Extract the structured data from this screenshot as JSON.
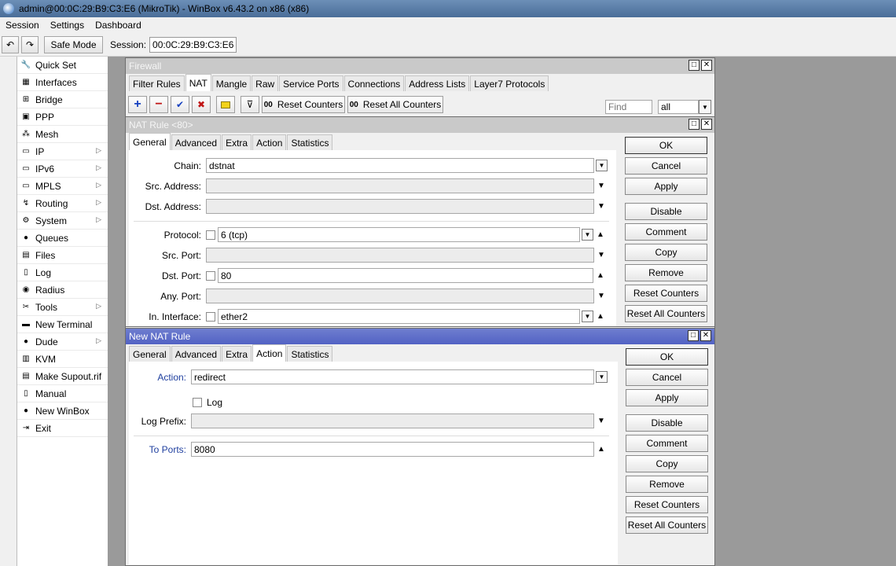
{
  "app": {
    "title": "admin@00:0C:29:B9:C3:E6 (MikroTik) - WinBox v6.43.2 on x86 (x86)"
  },
  "menu": [
    "Session",
    "Settings",
    "Dashboard"
  ],
  "toolbar": {
    "safe_mode": "Safe Mode",
    "session_label": "Session:",
    "session_value": "00:0C:29:B9:C3:E6"
  },
  "sidebar": [
    {
      "label": "Quick Set",
      "icon": "quickset-icon",
      "sub": false
    },
    {
      "label": "Interfaces",
      "icon": "interfaces-icon",
      "sub": false
    },
    {
      "label": "Bridge",
      "icon": "bridge-icon",
      "sub": false
    },
    {
      "label": "PPP",
      "icon": "ppp-icon",
      "sub": false
    },
    {
      "label": "Mesh",
      "icon": "mesh-icon",
      "sub": false
    },
    {
      "label": "IP",
      "icon": "ip-icon",
      "sub": true
    },
    {
      "label": "IPv6",
      "icon": "ipv6-icon",
      "sub": true
    },
    {
      "label": "MPLS",
      "icon": "mpls-icon",
      "sub": true
    },
    {
      "label": "Routing",
      "icon": "routing-icon",
      "sub": true
    },
    {
      "label": "System",
      "icon": "system-icon",
      "sub": true
    },
    {
      "label": "Queues",
      "icon": "queues-icon",
      "sub": false
    },
    {
      "label": "Files",
      "icon": "files-icon",
      "sub": false
    },
    {
      "label": "Log",
      "icon": "log-icon",
      "sub": false
    },
    {
      "label": "Radius",
      "icon": "radius-icon",
      "sub": false
    },
    {
      "label": "Tools",
      "icon": "tools-icon",
      "sub": true
    },
    {
      "label": "New Terminal",
      "icon": "terminal-icon",
      "sub": false
    },
    {
      "label": "Dude",
      "icon": "dude-icon",
      "sub": true
    },
    {
      "label": "KVM",
      "icon": "kvm-icon",
      "sub": false
    },
    {
      "label": "Make Supout.rif",
      "icon": "supout-icon",
      "sub": false
    },
    {
      "label": "Manual",
      "icon": "manual-icon",
      "sub": false
    },
    {
      "label": "New WinBox",
      "icon": "winbox-icon",
      "sub": false
    },
    {
      "label": "Exit",
      "icon": "exit-icon",
      "sub": false
    }
  ],
  "firewall": {
    "title": "Firewall",
    "tabs": [
      "Filter Rules",
      "NAT",
      "Mangle",
      "Raw",
      "Service Ports",
      "Connections",
      "Address Lists",
      "Layer7 Protocols"
    ],
    "selected_tab": "NAT",
    "reset_counters": "Reset Counters",
    "reset_all_counters": "Reset All Counters",
    "counter_prefix": "00",
    "find_placeholder": "Find",
    "filter_value": "all"
  },
  "nat_rule": {
    "title": "NAT Rule <80>",
    "tabs": [
      "General",
      "Advanced",
      "Extra",
      "Action",
      "Statistics"
    ],
    "selected_tab": "General",
    "fields": {
      "chain_label": "Chain:",
      "chain_value": "dstnat",
      "src_address_label": "Src. Address:",
      "dst_address_label": "Dst. Address:",
      "protocol_label": "Protocol:",
      "protocol_value": "6 (tcp)",
      "src_port_label": "Src. Port:",
      "dst_port_label": "Dst. Port:",
      "dst_port_value": "80",
      "any_port_label": "Any. Port:",
      "in_interface_label": "In. Interface:",
      "in_interface_value": "ether2"
    },
    "buttons": [
      "OK",
      "Cancel",
      "Apply",
      "Disable",
      "Comment",
      "Copy",
      "Remove",
      "Reset Counters",
      "Reset All Counters"
    ]
  },
  "new_nat_rule": {
    "title": "New NAT Rule",
    "tabs": [
      "General",
      "Advanced",
      "Extra",
      "Action",
      "Statistics"
    ],
    "selected_tab": "Action",
    "fields": {
      "action_label": "Action:",
      "action_value": "redirect",
      "log_label": "Log",
      "log_prefix_label": "Log Prefix:",
      "to_ports_label": "To Ports:",
      "to_ports_value": "8080"
    },
    "buttons": [
      "OK",
      "Cancel",
      "Apply",
      "Disable",
      "Comment",
      "Copy",
      "Remove",
      "Reset Counters",
      "Reset All Counters"
    ]
  },
  "colors": {
    "title_active": "#5262c4",
    "label_blue": "#1f3f9f",
    "desktop": "#9a9a9a"
  }
}
